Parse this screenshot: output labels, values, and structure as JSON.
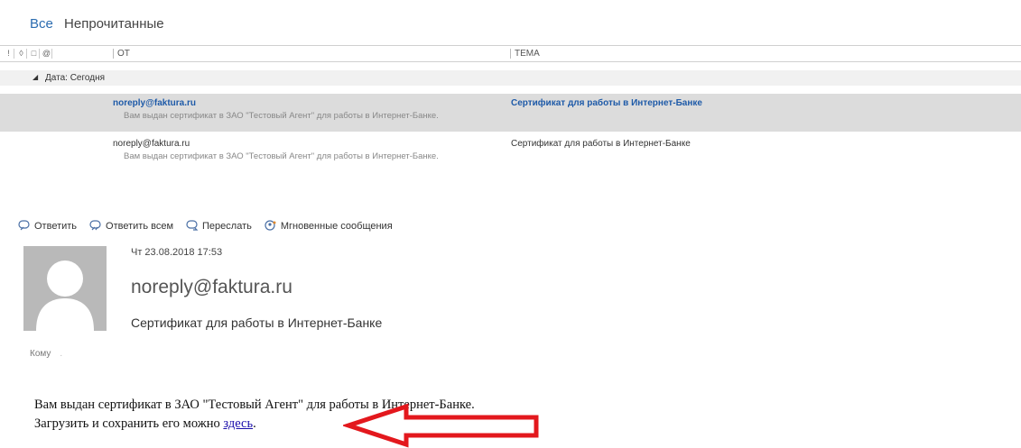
{
  "filter_tabs": {
    "all": "Все",
    "unread": "Непрочитанные"
  },
  "columns": {
    "from": "ОТ",
    "subject": "ТЕМА",
    "icons": [
      "importance-icon",
      "reminder-icon",
      "doc-icon",
      "attachment-icon"
    ]
  },
  "group": {
    "label": "Дата: Сегодня"
  },
  "messages": [
    {
      "from": "noreply@faktura.ru",
      "subject": "Сертификат для работы в Интернет-Банке",
      "preview": "Вам выдан сертификат в ЗАО \"Тестовый Агент\" для работы в Интернет-Банке.",
      "selected": true
    },
    {
      "from": "noreply@faktura.ru",
      "subject": "Сертификат для работы в Интернет-Банке",
      "preview": "Вам выдан сертификат в ЗАО \"Тестовый Агент\" для работы в Интернет-Банке.",
      "selected": false
    }
  ],
  "actions": {
    "reply": "Ответить",
    "reply_all": "Ответить всем",
    "forward": "Переслать",
    "im": "Мгновенные сообщения"
  },
  "reading": {
    "date": "Чт 23.08.2018 17:53",
    "sender": "noreply@faktura.ru",
    "subject": "Сертификат для работы в Интернет-Банке",
    "to_label": "Кому",
    "body_line1": "Вам выдан сертификат в ЗАО \"Тестовый Агент\" для работы в Интернет-Банке.",
    "body_line2": "Загрузить и сохранить его можно ",
    "link_text": "здесь",
    "after_link": "."
  },
  "colors": {
    "accent": "#2b6cb0",
    "selected_row": "#dcdcdc",
    "annotation_arrow": "#e3181d"
  }
}
